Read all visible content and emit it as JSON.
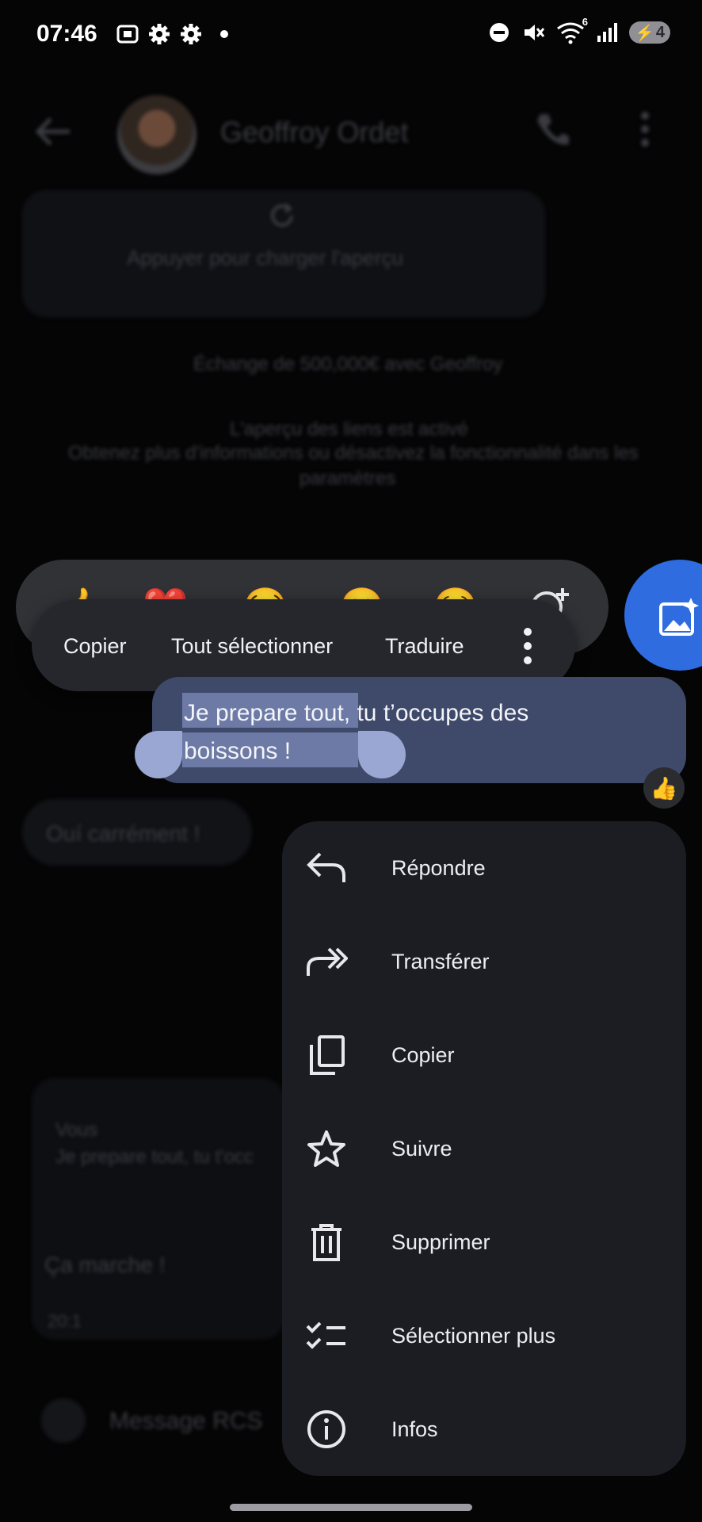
{
  "status_bar": {
    "time": "07:46",
    "battery": "4",
    "network_badge": "6"
  },
  "conversation": {
    "contact_name": "Geoffroy Ordet",
    "preview_prompt": "Appuyer pour charger l'aperçu",
    "info_line1": "Échange de 500,000€ avec Geoffroy",
    "info_line2": "L'aperçu des liens est activé",
    "info_line3": "Obtenez plus d'informations ou désactivez la fonctionnalité dans les",
    "info_line4": "paramètres",
    "received_message": "Ouí carrément !",
    "reply_card": {
      "sender": "Vous",
      "snippet": "Je prepare tout, tu t'occ",
      "received": "Ça marche !",
      "time": "20:1"
    },
    "compose_placeholder": "Message RCS"
  },
  "sent_message": {
    "line1_selected": "Je prepare tout",
    "line1_rest": ", tu t’occupes des",
    "line2_selected": "boissons !",
    "reaction": "👍"
  },
  "reactions": [
    "👍",
    "❤️",
    "😂",
    "😮",
    "😢"
  ],
  "selection_toolbar": {
    "copy": "Copier",
    "select_all": "Tout sélectionner",
    "translate": "Traduire"
  },
  "context_menu": [
    {
      "label": "Répondre",
      "icon": "reply-icon"
    },
    {
      "label": "Transférer",
      "icon": "forward-icon"
    },
    {
      "label": "Copier",
      "icon": "copy-icon"
    },
    {
      "label": "Suivre",
      "icon": "star-icon"
    },
    {
      "label": "Supprimer",
      "icon": "trash-icon"
    },
    {
      "label": "Sélectionner plus",
      "icon": "checklist-icon"
    },
    {
      "label": "Infos",
      "icon": "info-icon"
    }
  ]
}
